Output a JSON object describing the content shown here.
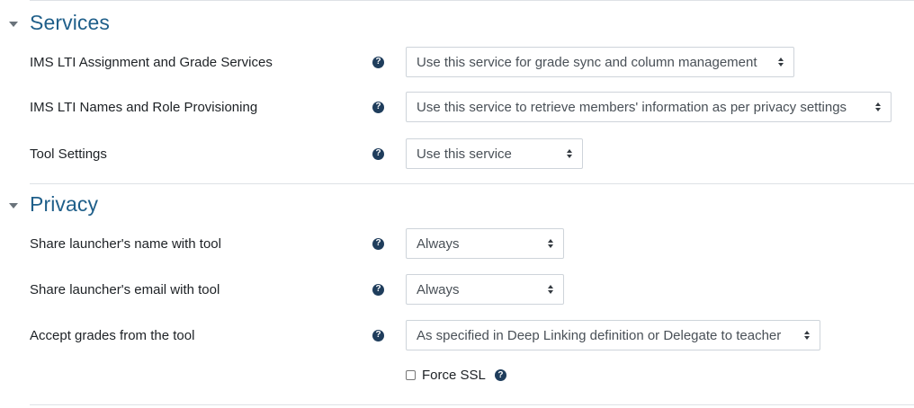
{
  "sections": [
    {
      "title": "Services",
      "rows": [
        {
          "label": "IMS LTI Assignment and Grade Services",
          "selected": "Use this service for grade sync and column management"
        },
        {
          "label": "IMS LTI Names and Role Provisioning",
          "selected": "Use this service to retrieve members' information as per privacy settings"
        },
        {
          "label": "Tool Settings",
          "selected": "Use this service"
        }
      ]
    },
    {
      "title": "Privacy",
      "rows": [
        {
          "label": "Share launcher's name with tool",
          "selected": "Always"
        },
        {
          "label": "Share launcher's email with tool",
          "selected": "Always"
        },
        {
          "label": "Accept grades from the tool",
          "selected": "As specified in Deep Linking definition or Delegate to teacher"
        }
      ]
    }
  ],
  "force_ssl": {
    "label": "Force SSL",
    "checked": false
  },
  "help_glyph": "?",
  "colors": {
    "section_title": "#1f5f8a",
    "help_icon": "#1f3d5c",
    "divider": "#dee2e6"
  }
}
